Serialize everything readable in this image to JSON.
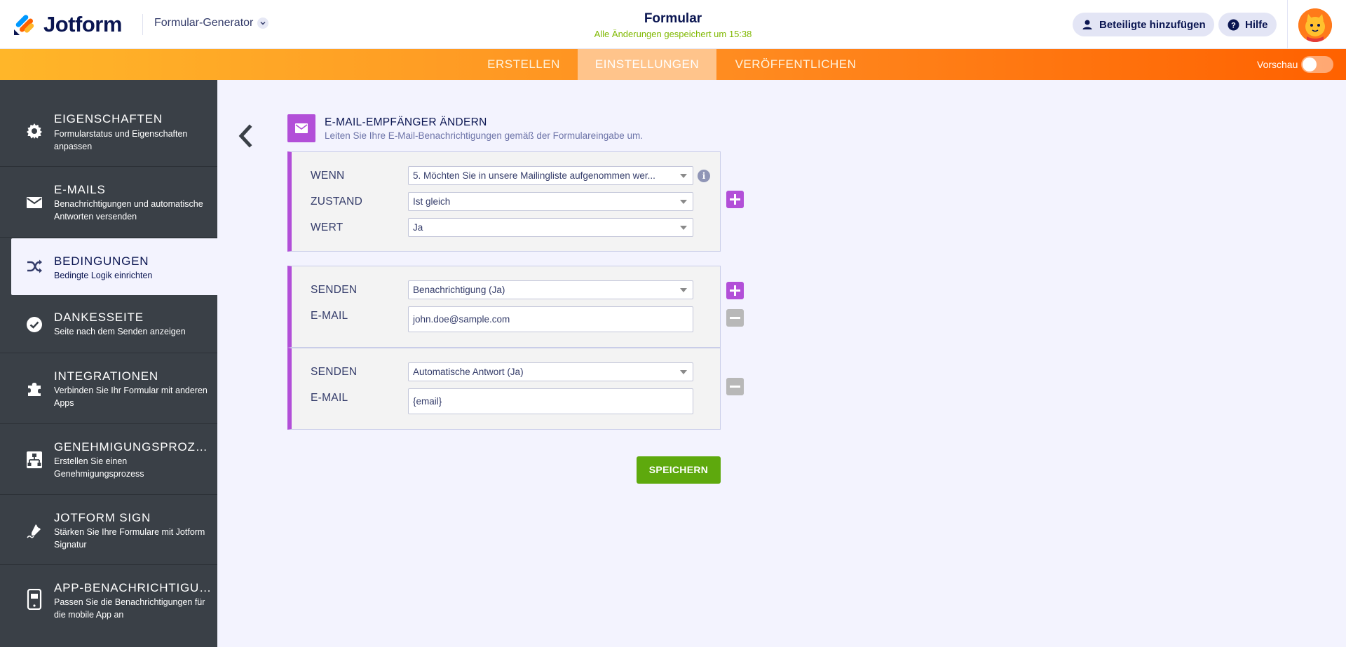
{
  "header": {
    "brand": "Jotform",
    "builder_label": "Formular-Generator",
    "form_title": "Formular",
    "save_status": "Alle Änderungen gespeichert um 15:38",
    "add_participants_label": "Beteiligte hinzufügen",
    "help_label": "Hilfe"
  },
  "tabs": [
    {
      "label": "ERSTELLEN",
      "active": false
    },
    {
      "label": "EINSTELLUNGEN",
      "active": true
    },
    {
      "label": "VERÖFFENTLICHEN",
      "active": false
    }
  ],
  "preview": {
    "label": "Vorschau",
    "enabled": false
  },
  "sidebar": {
    "items": [
      {
        "title": "EIGENSCHAFTEN",
        "desc": "Formularstatus und Eigenschaften anpassen",
        "icon": "gear-icon"
      },
      {
        "title": "E-MAILS",
        "desc": "Benachrichtigungen und automatische Antworten versenden",
        "icon": "envelope-icon"
      },
      {
        "title": "BEDINGUNGEN",
        "desc": "Bedingte Logik einrichten",
        "icon": "shuffle-icon",
        "active": true
      },
      {
        "title": "DANKESSEITE",
        "desc": "Seite nach dem Senden anzeigen",
        "icon": "check-circle-icon"
      },
      {
        "title": "INTEGRATIONEN",
        "desc": "Verbinden Sie Ihr Formular mit anderen Apps",
        "icon": "puzzle-icon"
      },
      {
        "title": "GENEHMIGUNGSPROZES...",
        "desc": "Erstellen Sie einen Genehmigungsprozess",
        "icon": "flow-icon"
      },
      {
        "title": "JOTFORM SIGN",
        "desc": "Stärken Sie Ihre Formulare mit Jotform Signatur",
        "icon": "pen-icon"
      },
      {
        "title": "APP-BENACHRICHTIGUNG",
        "desc": "Passen Sie die Benachrichtigungen für die mobile App an",
        "icon": "mobile-icon"
      }
    ]
  },
  "section": {
    "title": "E-MAIL-EMPFÄNGER ÄNDERN",
    "subtitle": "Leiten Sie Ihre E-Mail-Benachrichtigungen gemäß der Formulareingabe um."
  },
  "condition": {
    "if_label": "WENN",
    "if_value": "5. Möchten Sie in unsere Mailingliste aufgenommen wer...",
    "state_label": "ZUSTAND",
    "state_value": "Ist gleich",
    "value_label": "WERT",
    "value_value": "Ja"
  },
  "actions": [
    {
      "send_label": "SENDEN",
      "send_value": "Benachrichtigung (Ja)",
      "email_label": "E-MAIL",
      "email_value": "john.doe@sample.com"
    },
    {
      "send_label": "SENDEN",
      "send_value": "Automatische Antwort (Ja)",
      "email_label": "E-MAIL",
      "email_value": "{email}"
    }
  ],
  "save_label": "SPEICHERN",
  "colors": {
    "accent_purple": "#b24fd8",
    "save_green": "#5ea90d",
    "tab_orange": "#ff8b20",
    "sidebar_dark": "#3a4047"
  }
}
